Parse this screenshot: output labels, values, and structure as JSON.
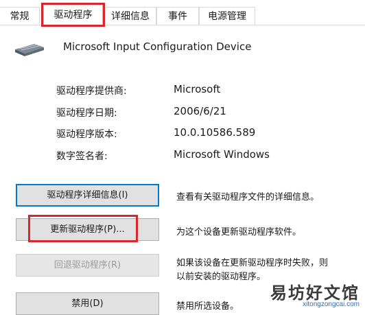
{
  "tabs": [
    "常规",
    "驱动程序",
    "详细信息",
    "事件",
    "电源管理"
  ],
  "active_tab": "驱动程序",
  "device": {
    "name": "Microsoft Input Configuration Device",
    "icon": "keyboard-device-icon"
  },
  "properties": [
    {
      "label": "驱动程序提供商:",
      "value": "Microsoft"
    },
    {
      "label": "驱动程序日期:",
      "value": "2006/6/21"
    },
    {
      "label": "驱动程序版本:",
      "value": "10.0.10586.589"
    },
    {
      "label": "数字签名者:",
      "value": "Microsoft Windows"
    }
  ],
  "buttons": [
    {
      "label": "驱动程序详细信息(I)",
      "description": "查看有关驱动程序文件的详细信息。",
      "state": "focused"
    },
    {
      "label": "更新驱动程序(P)...",
      "description": "为这个设备更新驱动程序软件。",
      "state": "normal"
    },
    {
      "label": "回退驱动程序(R)",
      "description_line1": "如果该设备在更新驱动程序时失败，则",
      "description_line2": "以前安装的驱动程序。",
      "state": "disabled"
    },
    {
      "label": "禁用(D)",
      "description": "禁用所选设备。",
      "state": "normal"
    }
  ],
  "watermark": {
    "main": "易坊好文馆",
    "sub": "xitongzongcai.com"
  },
  "colors": {
    "highlight": "#d9262c",
    "focus": "#0078d7"
  }
}
